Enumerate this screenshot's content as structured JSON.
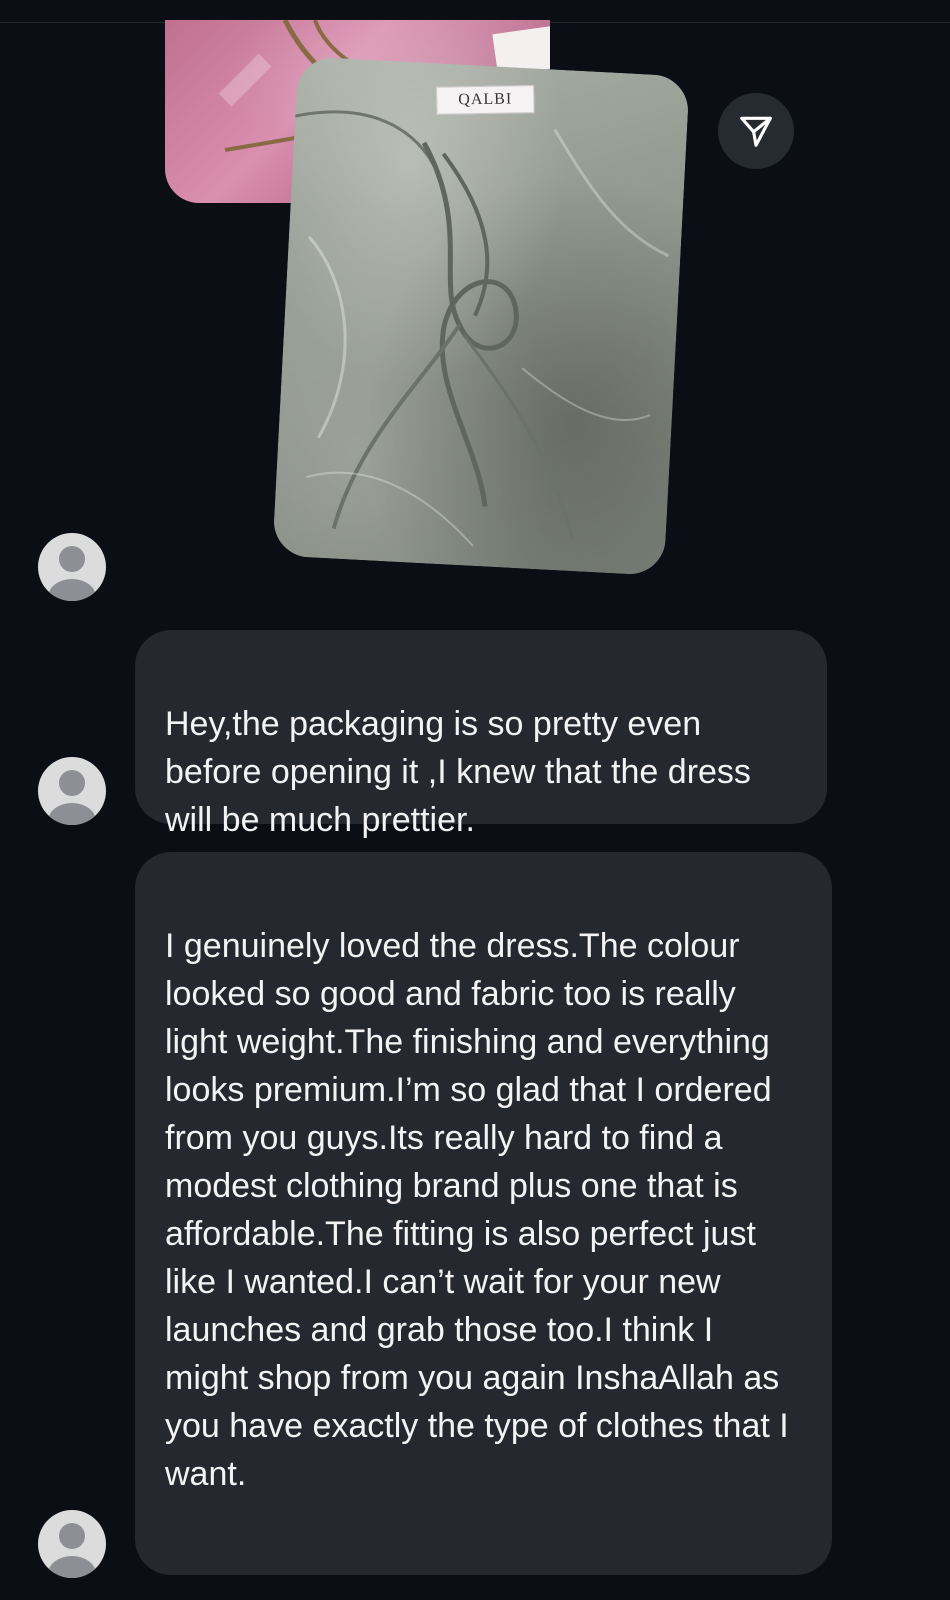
{
  "product_photo": {
    "brand_label": "QALBI",
    "alt": "photo-attachment"
  },
  "share": {
    "icon": "send-icon"
  },
  "messages": [
    {
      "text": "Hey,the packaging is so pretty even before opening it ,I knew that the dress will be much prettier."
    },
    {
      "text": "I genuinely loved the dress.The colour looked so good and fabric too is really light weight.The finishing and everything looks premium.I’m so glad that I ordered from you guys.Its really hard to find a modest clothing brand plus one that is affordable.The fitting is also perfect just like I wanted.I can’t wait for your new launches and grab those too.I think I might shop from you again InshaAllah as you have exactly the type of clothes that I want."
    }
  ],
  "colors": {
    "background": "#0b0e14",
    "bubble": "#25282e",
    "share_button": "#262a31",
    "avatar": "#dcdcdc",
    "text": "#f3f3f3"
  }
}
